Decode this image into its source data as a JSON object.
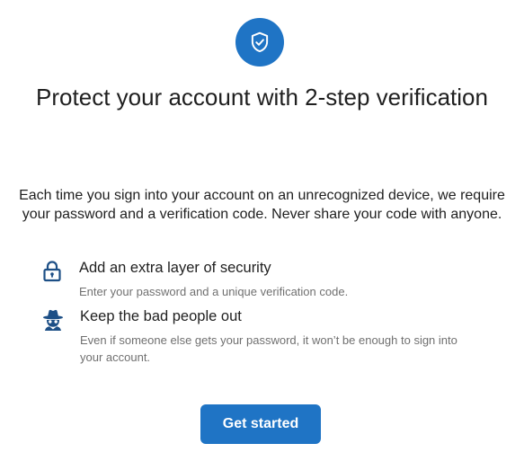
{
  "header": {
    "badge_icon": "shield-check-icon",
    "title": "Protect your account with 2-step verification"
  },
  "intro": {
    "description": "Each time you sign into your account on an unrecognized device, we require your password and a verification code. Never share your code with anyone."
  },
  "features": [
    {
      "icon": "padlock-icon",
      "heading": "Add an extra layer of security",
      "subtext": "Enter your password and a unique verification code."
    },
    {
      "icon": "spy-icon",
      "heading": "Keep the bad people out",
      "subtext": "Even if someone else gets your password, it won’t be enough to sign into your account."
    }
  ],
  "actions": {
    "primary_label": "Get started"
  },
  "colors": {
    "accent": "#1f74c5",
    "icon_dark": "#1d4f86",
    "text": "#1f1f1f",
    "muted_text": "#707070"
  }
}
